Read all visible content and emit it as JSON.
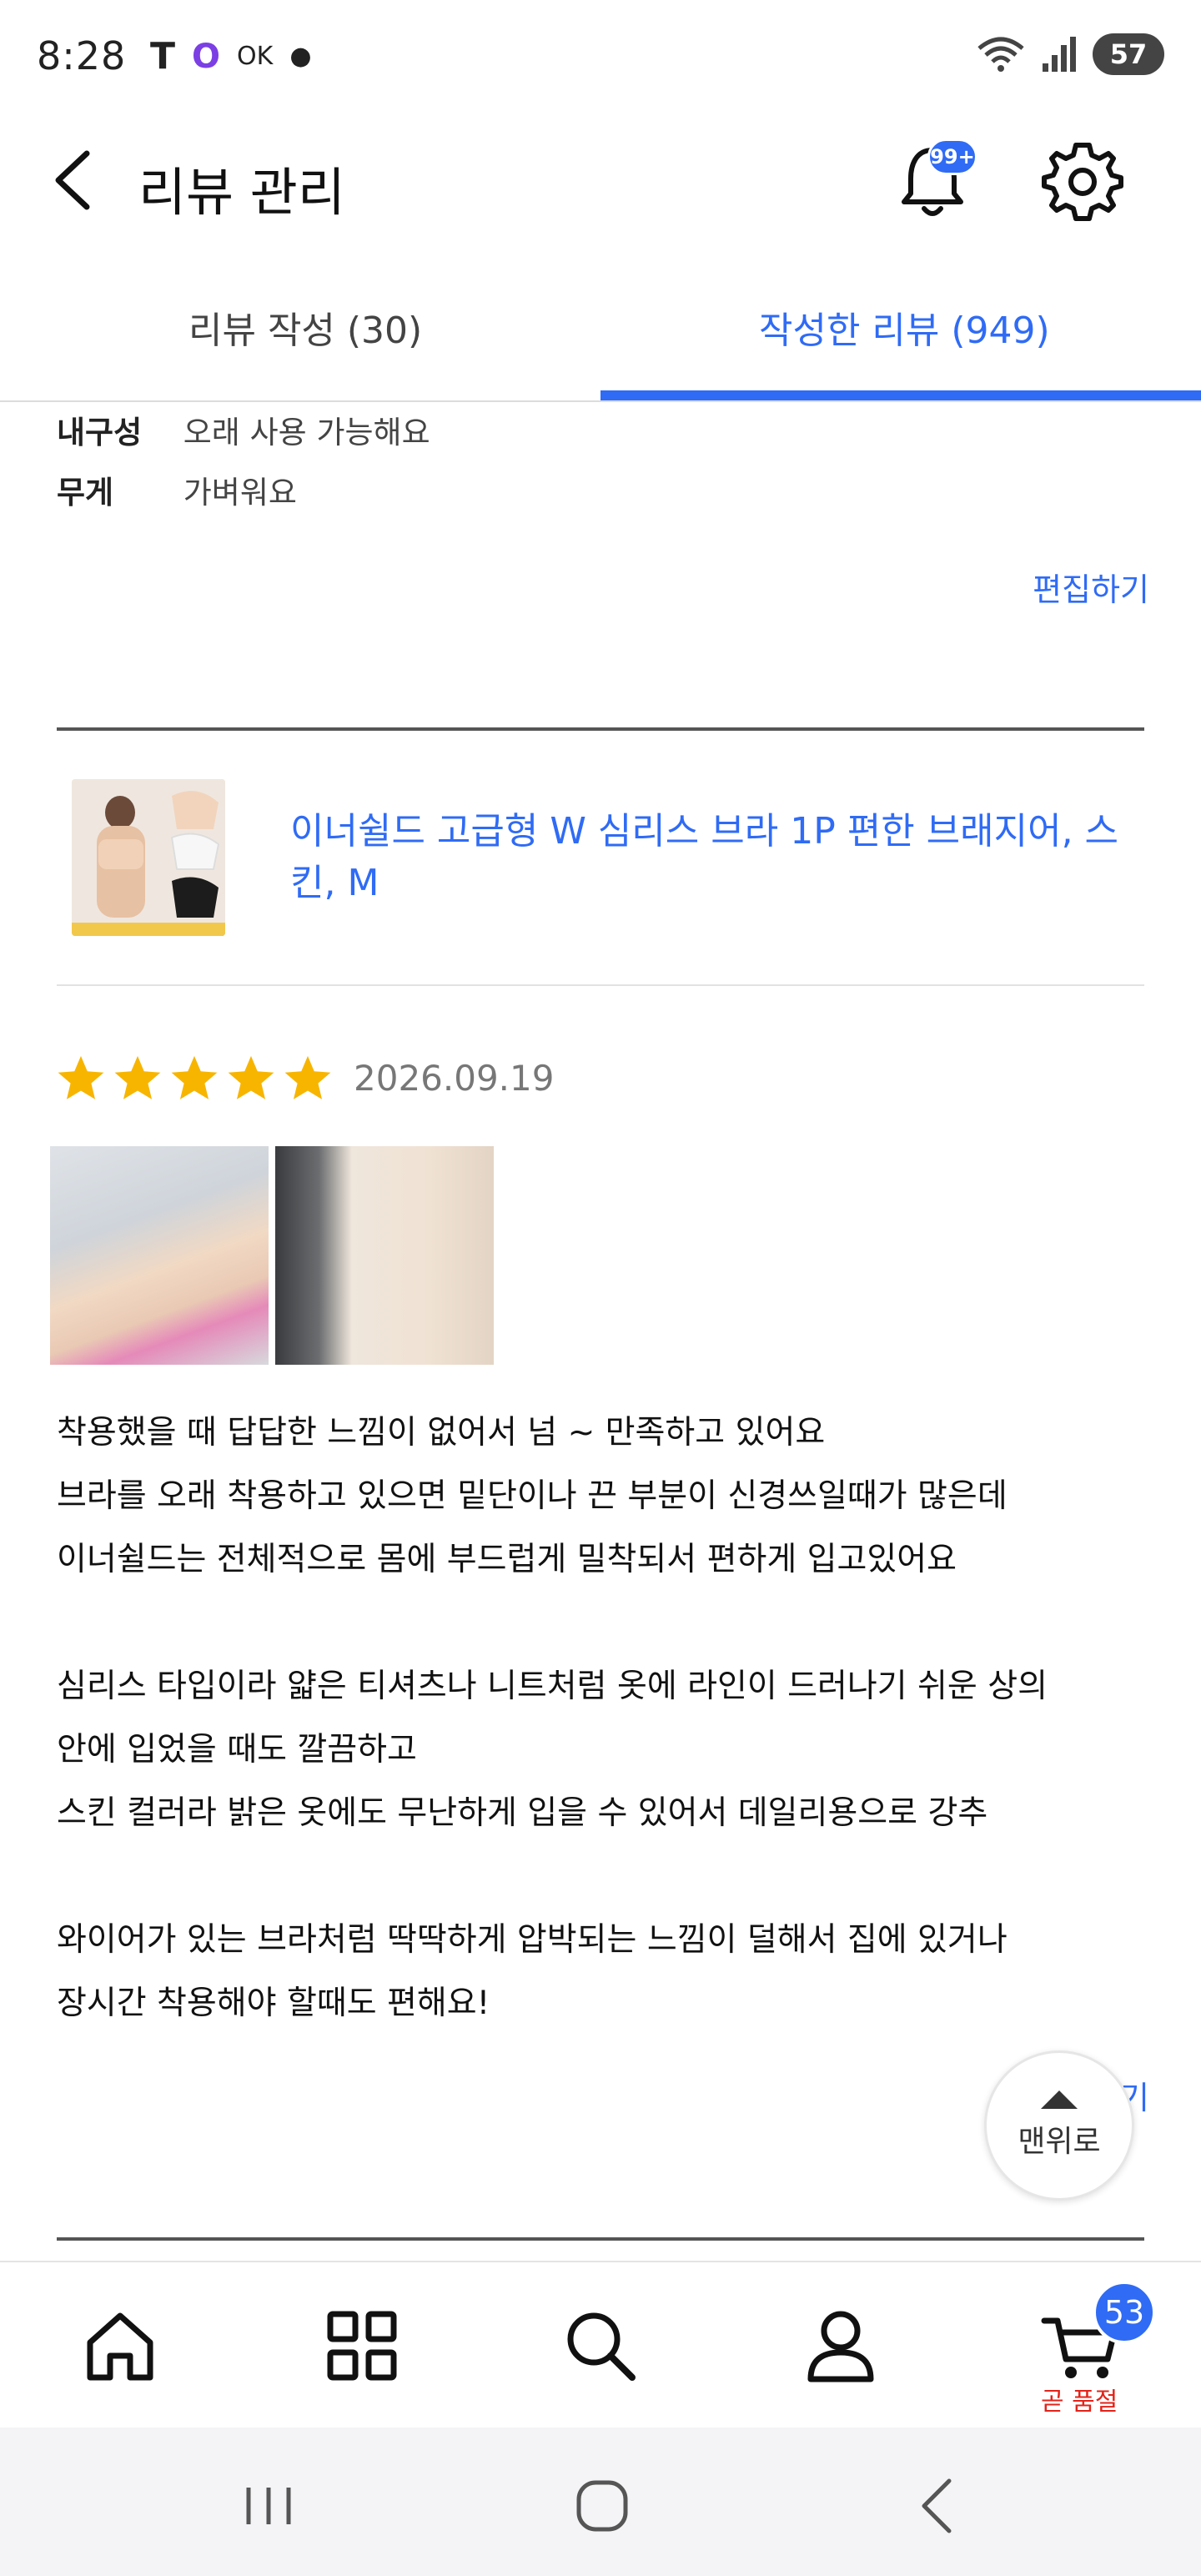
{
  "status_bar": {
    "time": "8:28",
    "left_icons": [
      "T",
      "O",
      "OK"
    ],
    "battery": "57"
  },
  "header": {
    "title": "리뷰 관리",
    "notification_badge": "99+"
  },
  "tabs": [
    {
      "label": "리뷰 작성 (30)",
      "active": false
    },
    {
      "label": "작성한 리뷰 (949)",
      "active": true
    }
  ],
  "previous_review": {
    "attributes": [
      {
        "label": "내구성",
        "value": "오래 사용 가능해요"
      },
      {
        "label": "무게",
        "value": "가벼워요"
      }
    ],
    "edit_label": "편집하기"
  },
  "review": {
    "product_name": "이너쉴드 고급형 W 심리스 브라 1P 편한 브래지어, 스킨, M",
    "rating": 5,
    "date": "2026.09.19",
    "text": "착용했을 때 답답한 느낌이 없어서 넘 ~ 만족하고 있어요\n브라를 오래 착용하고 있으면 밑단이나 끈 부분이 신경쓰일때가 많은데\n이너쉴드는 전체적으로 몸에 부드럽게 밀착되서 편하게 입고있어요\n\n심리스 타입이라 얇은 티셔츠나 니트처럼 옷에 라인이 드러나기 쉬운 상의\n안에 입었을 때도 깔끔하고\n스킨 컬러라 밝은 옷에도 무난하게 입을 수 있어서 데일리용으로 강추\n\n와이어가 있는 브라처럼 딱딱하게 압박되는 느낌이 덜해서 집에 있거나\n장시간 착용해야 할때도 편해요!",
    "edit_label": "편집하기"
  },
  "scroll_top": {
    "label": "맨위로"
  },
  "bottom_nav": {
    "cart_count": "53",
    "cart_label": "곧 품절"
  },
  "colors": {
    "accent": "#2f6bf5",
    "star": "#f7b500",
    "alert": "#e2231a"
  }
}
